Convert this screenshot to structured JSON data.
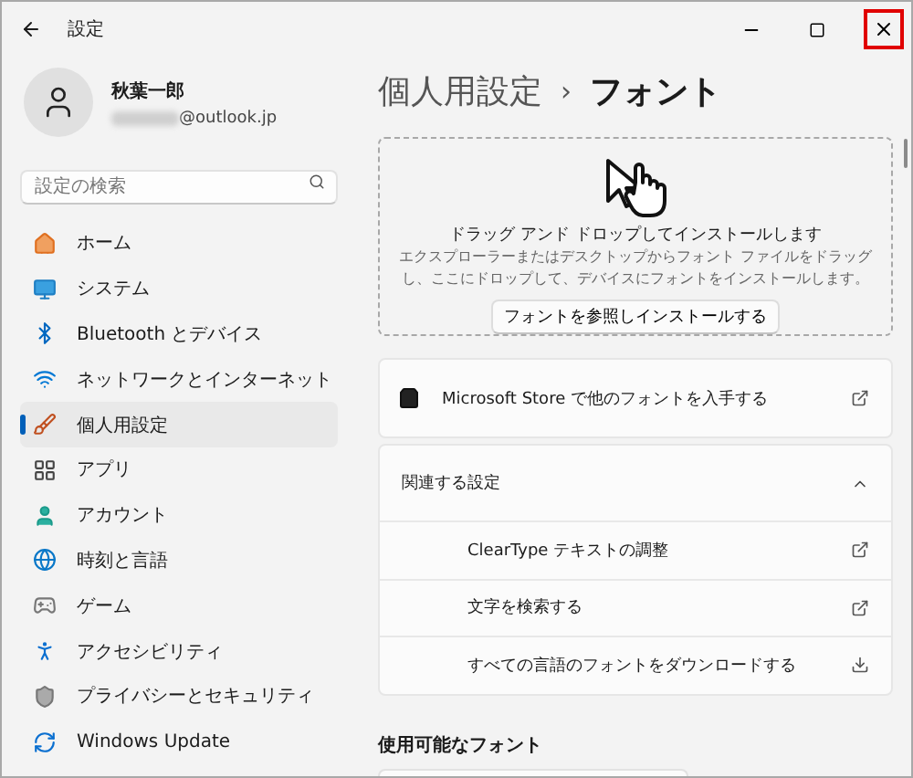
{
  "window": {
    "title": "設定",
    "close_highlighted": true
  },
  "user": {
    "name": "秋葉一郎",
    "email": "@outlook.jp"
  },
  "search": {
    "placeholder": "設定の検索"
  },
  "nav": [
    {
      "label": "ホーム",
      "selected": false
    },
    {
      "label": "システム",
      "selected": false
    },
    {
      "label": "Bluetooth とデバイス",
      "selected": false
    },
    {
      "label": "ネットワークとインターネット",
      "selected": false
    },
    {
      "label": "個人用設定",
      "selected": true
    },
    {
      "label": "アプリ",
      "selected": false
    },
    {
      "label": "アカウント",
      "selected": false
    },
    {
      "label": "時刻と言語",
      "selected": false
    },
    {
      "label": "ゲーム",
      "selected": false
    },
    {
      "label": "アクセシビリティ",
      "selected": false
    },
    {
      "label": "プライバシーとセキュリティ",
      "selected": false
    },
    {
      "label": "Windows Update",
      "selected": false
    }
  ],
  "breadcrumb": {
    "parent": "個人用設定",
    "separator": "›",
    "current": "フォント"
  },
  "dropzone": {
    "title": "ドラッグ アンド ドロップしてインストールします",
    "description": "エクスプローラーまたはデスクトップからフォント ファイルをドラッグし、ここにドロップして、デバイスにフォントをインストールします。",
    "button": "フォントを参照しインストールする"
  },
  "store_link": {
    "label": "Microsoft Store で他のフォントを入手する"
  },
  "related": {
    "title": "関連する設定",
    "expanded": true,
    "items": [
      {
        "label": "ClearType テキストの調整",
        "kind": "external"
      },
      {
        "label": "文字を検索する",
        "kind": "external"
      },
      {
        "label": "すべての言語のフォントをダウンロードする",
        "kind": "download"
      }
    ]
  },
  "available_fonts": {
    "title": "使用可能なフォント"
  }
}
